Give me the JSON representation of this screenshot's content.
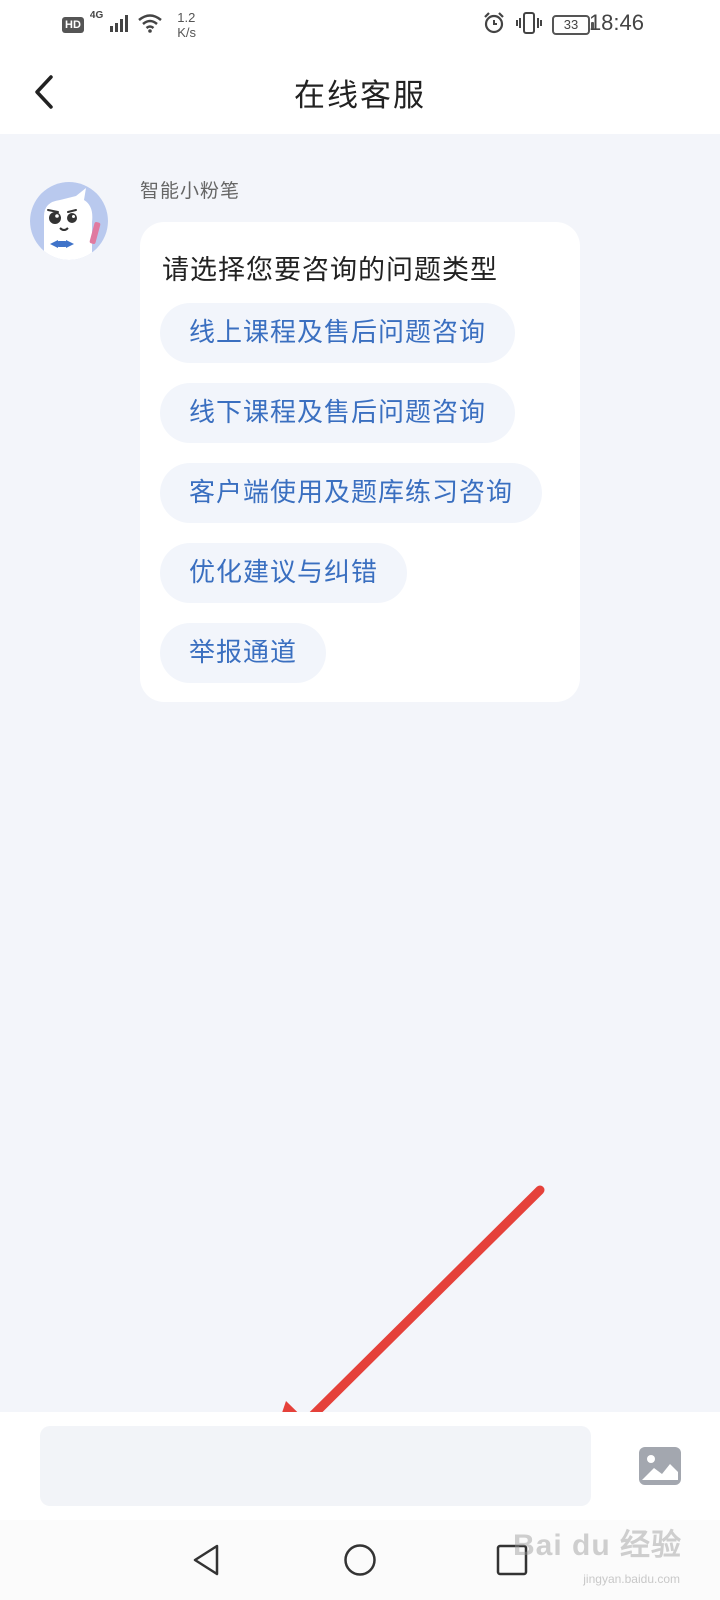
{
  "status_bar": {
    "hd": "HD",
    "network_type": "4G",
    "speed_value": "1.2",
    "speed_unit": "K/s",
    "battery": "33",
    "time": "18:46",
    "icons": [
      "signal-icon",
      "wifi-icon",
      "alarm-icon",
      "vibrate-icon",
      "battery-icon"
    ]
  },
  "header": {
    "title": "在线客服",
    "back_icon": "chevron-left-icon"
  },
  "chat": {
    "bot_name": "智能小粉笔",
    "prompt": "请选择您要咨询的问题类型",
    "options": [
      "线上课程及售后问题咨询",
      "线下课程及售后问题咨询",
      "客户端使用及题库练习咨询",
      "优化建议与纠错",
      "举报通道"
    ]
  },
  "input": {
    "placeholder": "",
    "image_icon": "image-icon"
  },
  "nav": {
    "icons": [
      "nav-back-icon",
      "nav-home-icon",
      "nav-recent-icon"
    ]
  },
  "watermark": {
    "brand": "Bai du 经验",
    "site": "jingyan.baidu.com"
  },
  "colors": {
    "accent": "#3a6fc0",
    "background": "#f3f5fa",
    "annotation_arrow": "#e5413a"
  }
}
